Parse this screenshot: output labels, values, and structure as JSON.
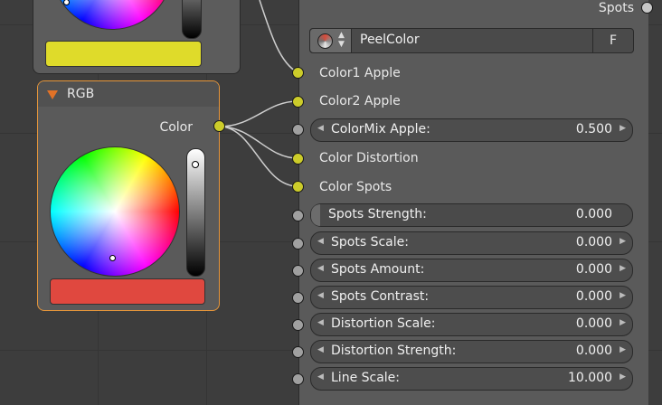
{
  "rgb_node": {
    "title": "RGB",
    "output_label": "Color",
    "swatch_color": "#e0483f"
  },
  "top_node": {
    "swatch_color": "#dfdb2a"
  },
  "right_node": {
    "spots_label": "Spots",
    "material": {
      "name": "PeelColor",
      "fake_user": "F"
    },
    "color_inputs": [
      "Color1 Apple",
      "Color2 Apple"
    ],
    "colormix": {
      "label": "ColorMix Apple:",
      "value": "0.500"
    },
    "color_inputs_2": [
      "Color Distortion",
      "Color Spots"
    ],
    "fields": [
      {
        "label": "Spots Strength:",
        "value": "0.000"
      },
      {
        "label": "Spots Scale:",
        "value": "0.000"
      },
      {
        "label": "Spots Amount:",
        "value": "0.000"
      },
      {
        "label": "Spots Contrast:",
        "value": "0.000"
      },
      {
        "label": "Distortion Scale:",
        "value": "0.000"
      },
      {
        "label": "Distortion Strength:",
        "value": "0.000"
      },
      {
        "label": "Line Scale:",
        "value": "10.000"
      }
    ]
  },
  "colors": {
    "socket_color": "#cccc2a",
    "socket_value": "#a0a0a0",
    "rgb_border": "#e7963a",
    "header_triangle": "#e27227"
  }
}
